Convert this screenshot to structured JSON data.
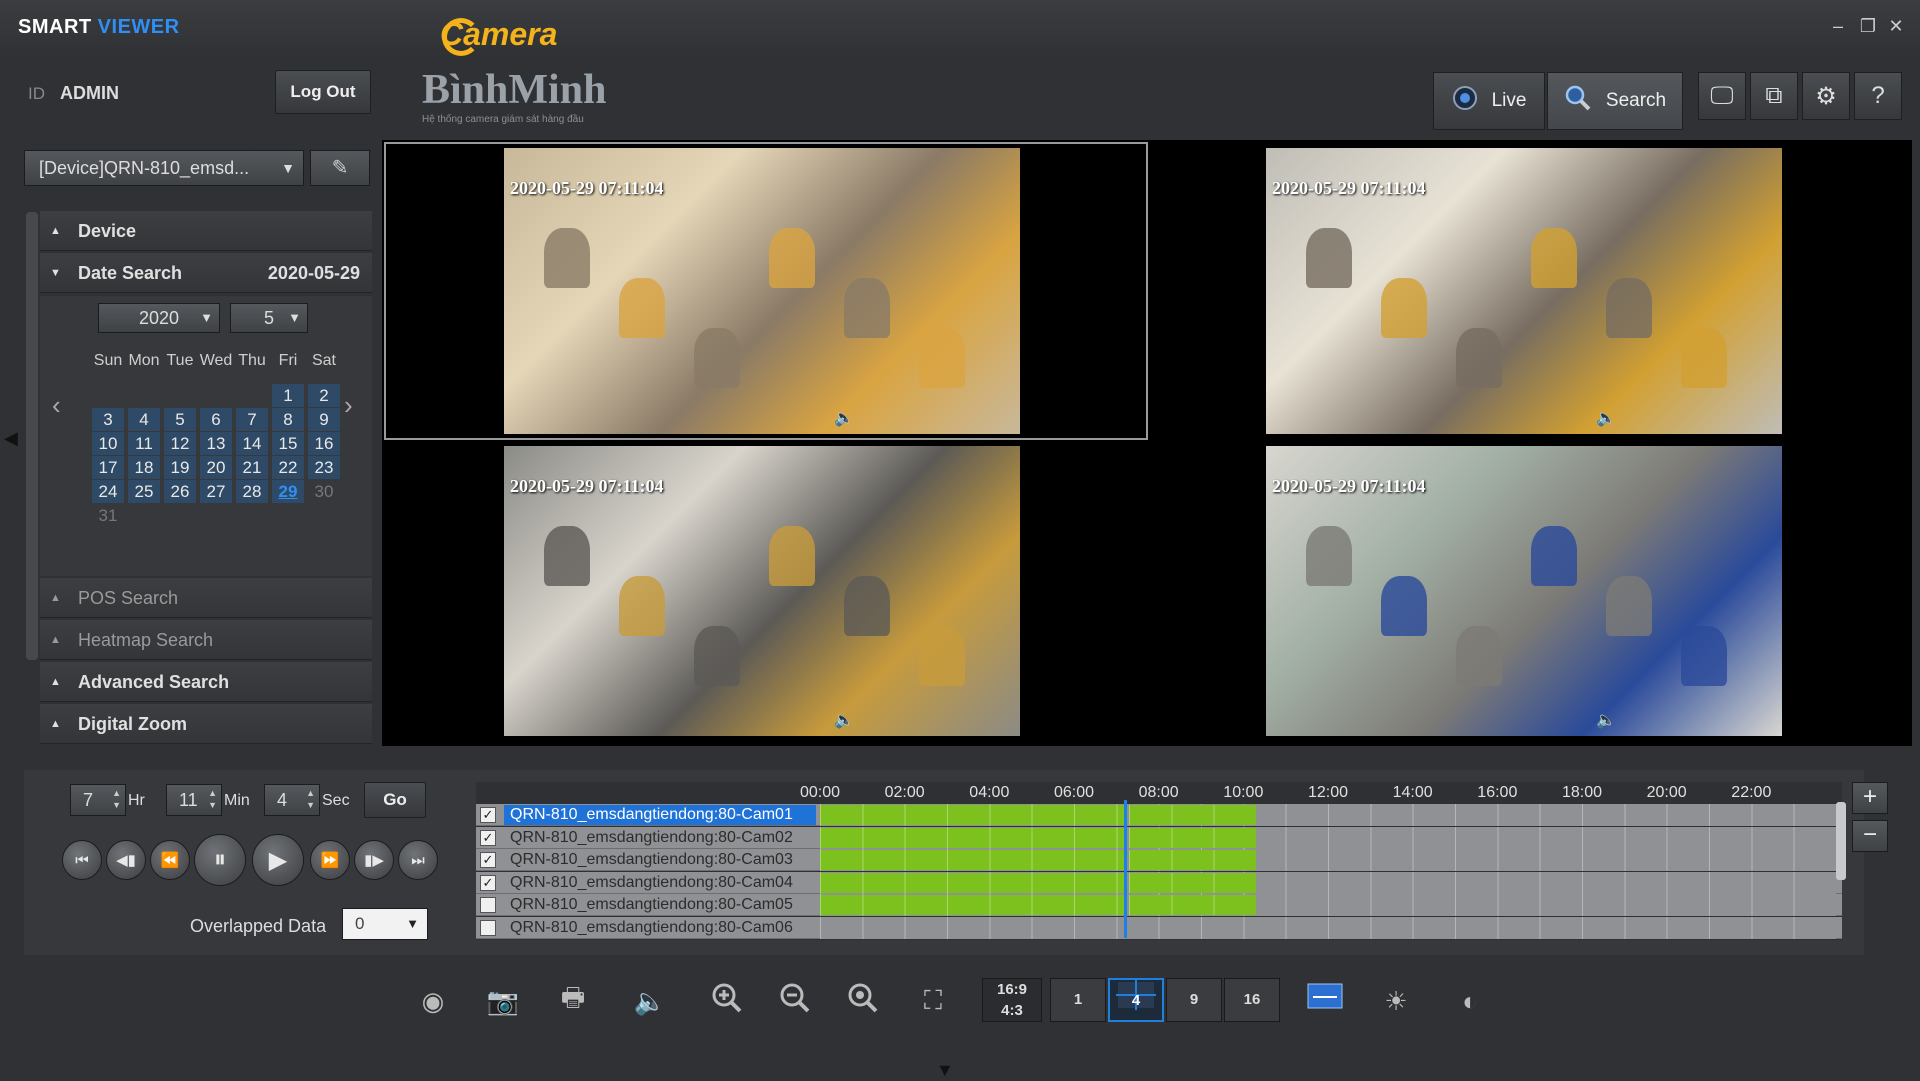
{
  "app": {
    "name_a": "SMART",
    "name_b": "VIEWER"
  },
  "logo": {
    "camera": "Camera",
    "brand": "BìnhMinh",
    "slogan": "Hệ thống camera giám sát hàng đầu"
  },
  "window_controls": {
    "minimize": "–",
    "restore": "❐",
    "close": "✕"
  },
  "user": {
    "id_label": "ID",
    "name": "ADMIN",
    "logout_label": "Log Out"
  },
  "modes": {
    "live": "Live",
    "search": "Search"
  },
  "device_select": {
    "value": "[Device]QRN-810_emsd..."
  },
  "sections": {
    "device": "Device",
    "date_search": "Date Search",
    "date_value": "2020-05-29",
    "pos_search": "POS Search",
    "heatmap_search": "Heatmap Search",
    "advanced_search": "Advanced Search",
    "digital_zoom": "Digital Zoom"
  },
  "calendar": {
    "year": "2020",
    "month": "5",
    "weekdays": [
      "Sun",
      "Mon",
      "Tue",
      "Wed",
      "Thu",
      "Fri",
      "Sat"
    ],
    "selected": 29,
    "days_with_data": [
      1,
      2,
      3,
      4,
      5,
      6,
      7,
      8,
      9,
      10,
      11,
      12,
      13,
      14,
      15,
      16,
      17,
      18,
      19,
      20,
      21,
      22,
      23,
      24,
      25,
      26,
      27,
      28,
      29
    ],
    "first_weekday": 5,
    "days_in_month": 31
  },
  "cameras": [
    {
      "timestamp": "2020-05-29 07:11:04",
      "scene_colors": [
        "#c8b89a",
        "#d9a441",
        "#8a7a66",
        "#e5d6b8"
      ]
    },
    {
      "timestamp": "2020-05-29 07:11:04",
      "scene_colors": [
        "#bfbdb6",
        "#d2a032",
        "#776d60",
        "#e8e2d5"
      ]
    },
    {
      "timestamp": "2020-05-29 07:11:04",
      "scene_colors": [
        "#8b8b86",
        "#c79b3c",
        "#5c5a56",
        "#d8d4cc"
      ]
    },
    {
      "timestamp": "2020-05-29 07:11:04",
      "scene_colors": [
        "#d8d6d0",
        "#2a4a9a",
        "#7c7a76",
        "#a3b0a5"
      ]
    }
  ],
  "time_entry": {
    "hour": "7",
    "hour_unit": "Hr",
    "min": "11",
    "min_unit": "Min",
    "sec": "4",
    "sec_unit": "Sec",
    "go_label": "Go"
  },
  "playback": {
    "overlapped_label": "Overlapped Data",
    "overlapped_value": "0"
  },
  "timeline": {
    "hours": [
      "00:00",
      "02:00",
      "04:00",
      "06:00",
      "08:00",
      "10:00",
      "12:00",
      "14:00",
      "16:00",
      "18:00",
      "20:00",
      "22:00"
    ],
    "cursor_hour": 7.18,
    "channels": [
      {
        "name": "QRN-810_emsdangtiendong:80-Cam01",
        "checked": true,
        "selected": true,
        "segments": [
          [
            0,
            7.2
          ],
          [
            7.3,
            10.3
          ]
        ]
      },
      {
        "name": "QRN-810_emsdangtiendong:80-Cam02",
        "checked": true,
        "selected": false,
        "segments": [
          [
            0,
            7.2
          ],
          [
            7.3,
            10.3
          ]
        ]
      },
      {
        "name": "QRN-810_emsdangtiendong:80-Cam03",
        "checked": true,
        "selected": false,
        "segments": [
          [
            0,
            7.2
          ],
          [
            7.3,
            10.3
          ]
        ]
      },
      {
        "name": "QRN-810_emsdangtiendong:80-Cam04",
        "checked": true,
        "selected": false,
        "segments": [
          [
            0,
            7.2
          ],
          [
            7.3,
            10.3
          ]
        ]
      },
      {
        "name": "QRN-810_emsdangtiendong:80-Cam05",
        "checked": false,
        "selected": false,
        "segments": [
          [
            0,
            7.2
          ],
          [
            7.3,
            10.3
          ]
        ]
      },
      {
        "name": "QRN-810_emsdangtiendong:80-Cam06",
        "checked": false,
        "selected": false,
        "segments": []
      }
    ]
  },
  "toolbar": {
    "ratio_a": "16:9",
    "ratio_b": "4:3",
    "layout_1": "1",
    "layout_4": "4",
    "layout_9": "9",
    "layout_16": "16"
  },
  "colors": {
    "accent": "#2f8ff5",
    "recording": "#7dc11e",
    "cursor": "#1a82e6"
  }
}
